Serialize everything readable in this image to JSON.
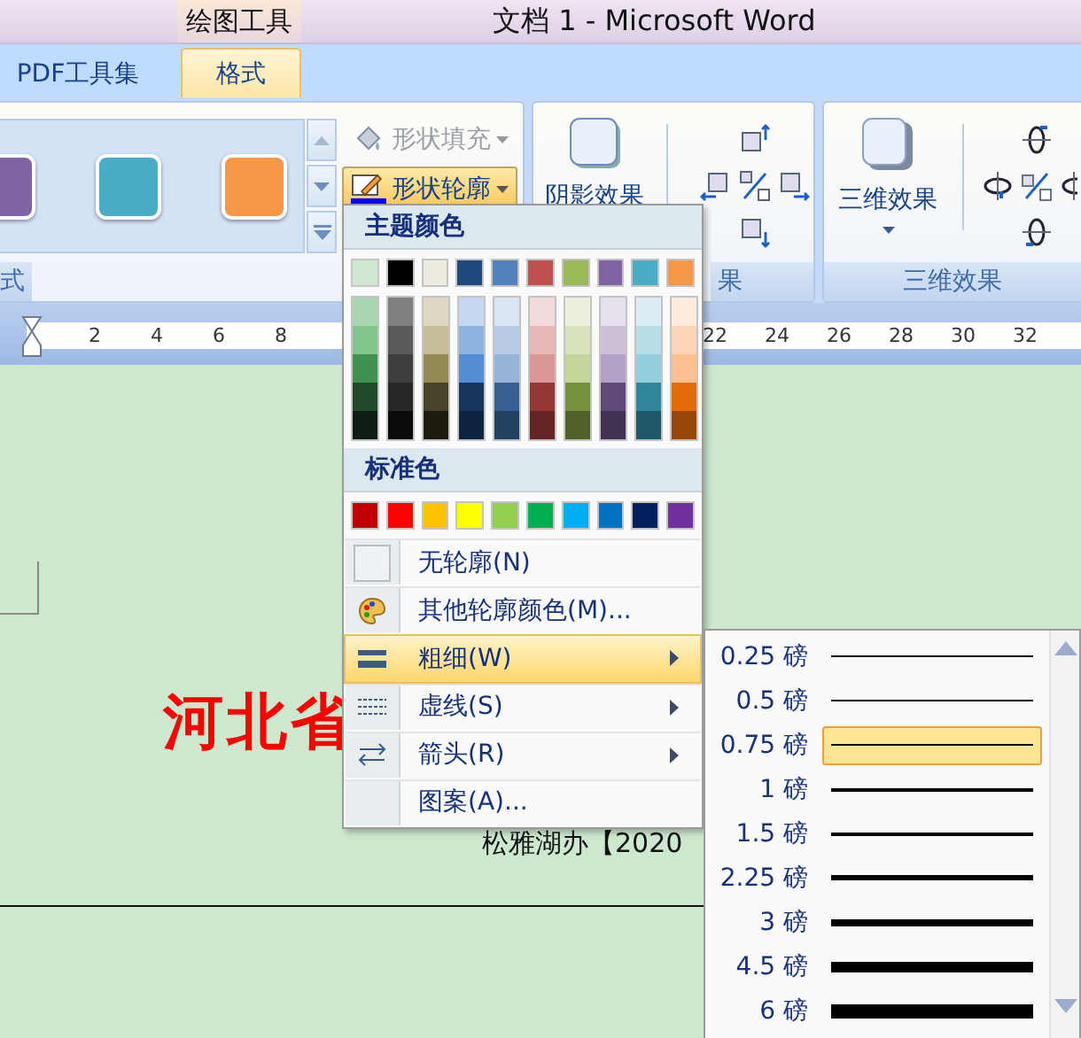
{
  "title_bar": {
    "context_tab": "绘图工具",
    "title": "文档 1 - Microsoft Word"
  },
  "tabs": [
    {
      "label": "PDF工具集",
      "selected": false
    },
    {
      "label": "格式",
      "selected": true
    }
  ],
  "ribbon": {
    "gallery": {
      "shapes": [
        {
          "color": "#8064a2"
        },
        {
          "color": "#4bacc6"
        },
        {
          "color": "#f79646"
        }
      ],
      "group_label": "式"
    },
    "fill_button": {
      "label": "形状填充",
      "disabled": true
    },
    "outline_button": {
      "label": "形状轮廓",
      "active": true
    },
    "shadow_group": {
      "button_label": "阴影效果",
      "group_label": "果"
    },
    "effects_group": {
      "button_label": "三维效果",
      "group_label": "三维效果"
    }
  },
  "ruler": {
    "left_labels": [
      "2",
      "4",
      "6",
      "8"
    ],
    "right_labels": [
      "22",
      "24",
      "26",
      "28",
      "30",
      "32"
    ]
  },
  "document": {
    "heading": "河北省",
    "line": "松雅湖办【2020"
  },
  "outline_menu": {
    "theme_header": "主题颜色",
    "theme_colors": [
      {
        "color": "#cde8d3"
      },
      {
        "color": "#000000"
      },
      {
        "color": "#eeece1"
      },
      {
        "color": "#1f497d"
      },
      {
        "color": "#4f81bd"
      },
      {
        "color": "#c0504d"
      },
      {
        "color": "#9bbb59"
      },
      {
        "color": "#8064a2"
      },
      {
        "color": "#4bacc6"
      },
      {
        "color": "#f79646"
      }
    ],
    "tint_columns": [
      {
        "shades": [
          {
            "color": "#a9d8b0"
          },
          {
            "color": "#80c58c"
          },
          {
            "color": "#3f934f"
          },
          {
            "color": "#1f4a28"
          },
          {
            "color": "#0f1e12"
          }
        ]
      },
      {
        "shades": [
          {
            "color": "#7f7f7f"
          },
          {
            "color": "#595959"
          },
          {
            "color": "#3f3f3f"
          },
          {
            "color": "#262626"
          },
          {
            "color": "#0c0c0c"
          }
        ]
      },
      {
        "shades": [
          {
            "color": "#ddd9c3"
          },
          {
            "color": "#c4bd97"
          },
          {
            "color": "#938953"
          },
          {
            "color": "#494429"
          },
          {
            "color": "#1d1b10"
          }
        ]
      },
      {
        "shades": [
          {
            "color": "#c6d9f0"
          },
          {
            "color": "#8db3e2"
          },
          {
            "color": "#548dd4"
          },
          {
            "color": "#17365d"
          },
          {
            "color": "#0f243e"
          }
        ]
      },
      {
        "shades": [
          {
            "color": "#dbe5f1"
          },
          {
            "color": "#b8cce4"
          },
          {
            "color": "#95b3d7"
          },
          {
            "color": "#366092"
          },
          {
            "color": "#244061"
          }
        ]
      },
      {
        "shades": [
          {
            "color": "#f2dcdb"
          },
          {
            "color": "#e5b9b7"
          },
          {
            "color": "#d99694"
          },
          {
            "color": "#953734"
          },
          {
            "color": "#632423"
          }
        ]
      },
      {
        "shades": [
          {
            "color": "#ebf1dd"
          },
          {
            "color": "#d7e3bc"
          },
          {
            "color": "#c3d69b"
          },
          {
            "color": "#76923c"
          },
          {
            "color": "#4f6128"
          }
        ]
      },
      {
        "shades": [
          {
            "color": "#e5e0ec"
          },
          {
            "color": "#ccc1d9"
          },
          {
            "color": "#b2a2c7"
          },
          {
            "color": "#5f497a"
          },
          {
            "color": "#3f3151"
          }
        ]
      },
      {
        "shades": [
          {
            "color": "#dbeef3"
          },
          {
            "color": "#b7dde8"
          },
          {
            "color": "#92cddc"
          },
          {
            "color": "#31859b"
          },
          {
            "color": "#205867"
          }
        ]
      },
      {
        "shades": [
          {
            "color": "#fdeada"
          },
          {
            "color": "#fbd5b5"
          },
          {
            "color": "#fac08f"
          },
          {
            "color": "#e36c09"
          },
          {
            "color": "#974806"
          }
        ]
      }
    ],
    "standard_header": "标准色",
    "standard_colors": [
      {
        "color": "#c00000"
      },
      {
        "color": "#ff0000"
      },
      {
        "color": "#ffc000"
      },
      {
        "color": "#ffff00"
      },
      {
        "color": "#92d050"
      },
      {
        "color": "#00b050"
      },
      {
        "color": "#00b0f0"
      },
      {
        "color": "#0070c0"
      },
      {
        "color": "#002060"
      },
      {
        "color": "#7030a0"
      }
    ],
    "items": [
      {
        "kind": "none",
        "label": "无轮廓(N)",
        "submenu": false,
        "selected": false
      },
      {
        "kind": "palette",
        "label": "其他轮廓颜色(M)...",
        "submenu": false,
        "selected": false
      },
      {
        "kind": "weight",
        "label": "粗细(W)",
        "submenu": true,
        "selected": true
      },
      {
        "kind": "dash",
        "label": "虚线(S)",
        "submenu": true,
        "selected": false
      },
      {
        "kind": "arrows",
        "label": "箭头(R)",
        "submenu": true,
        "selected": false
      },
      {
        "kind": "pattern",
        "label": "图案(A)...",
        "submenu": false,
        "selected": false
      }
    ]
  },
  "weight_menu": {
    "items": [
      {
        "label": "0.25 磅",
        "selected": false
      },
      {
        "label": "0.5 磅",
        "selected": false
      },
      {
        "label": "0.75 磅",
        "selected": true
      },
      {
        "label": "1 磅",
        "selected": false
      },
      {
        "label": "1.5 磅",
        "selected": false
      },
      {
        "label": "2.25 磅",
        "selected": false
      },
      {
        "label": "3 磅",
        "selected": false
      },
      {
        "label": "4.5 磅",
        "selected": false
      },
      {
        "label": "6 磅",
        "selected": false
      }
    ]
  }
}
